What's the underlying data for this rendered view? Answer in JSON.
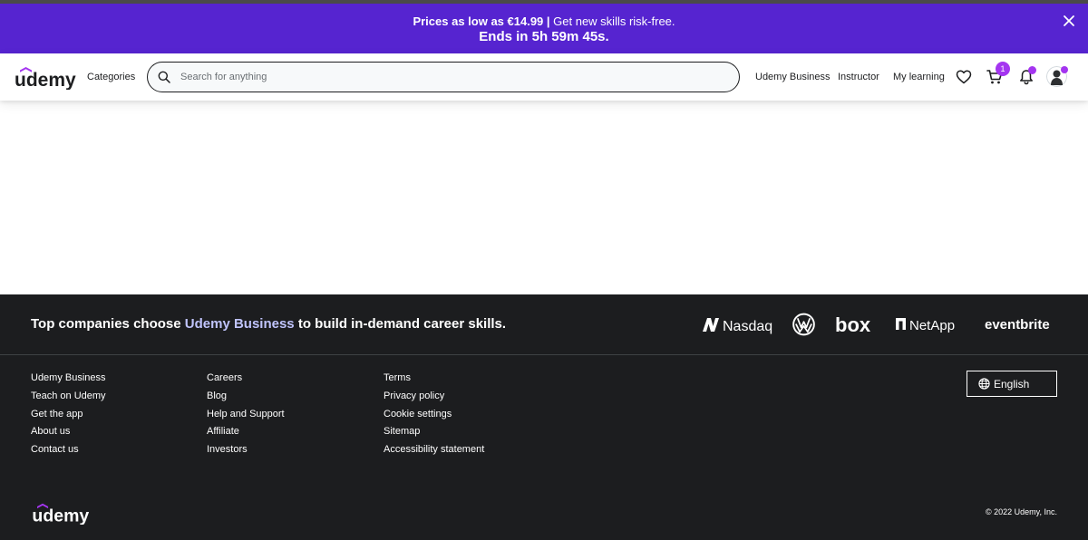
{
  "banner": {
    "bold_text": "Prices as low as €14.99 |",
    "regular_text": "Get new skills risk-free.",
    "countdown": "Ends in 5h 59m 45s."
  },
  "header": {
    "logo_text": "udemy",
    "categories": "Categories",
    "search_placeholder": "Search for anything",
    "udemy_business": "Udemy Business",
    "instructor": "Instructor",
    "my_learning": "My learning",
    "cart_count": "1"
  },
  "footer": {
    "tagline_pre": "Top companies choose",
    "tagline_highlight": "Udemy Business",
    "tagline_post": "to build in-demand career skills.",
    "brands": [
      "Nasdaq",
      "Volkswagen",
      "box",
      "NetApp",
      "eventbrite"
    ],
    "columns": [
      [
        "Udemy Business",
        "Teach on Udemy",
        "Get the app",
        "About us",
        "Contact us"
      ],
      [
        "Careers",
        "Blog",
        "Help and Support",
        "Affiliate",
        "Investors"
      ],
      [
        "Terms",
        "Privacy policy",
        "Cookie settings",
        "Sitemap",
        "Accessibility statement"
      ]
    ],
    "language": "English",
    "logo_text": "udemy",
    "copyright": "© 2022 Udemy, Inc."
  },
  "colors": {
    "brand_purple": "#a435f0",
    "banner_bg": "#5624d0",
    "footer_bg": "#1c1d1f",
    "highlight": "#c0c4fc"
  }
}
